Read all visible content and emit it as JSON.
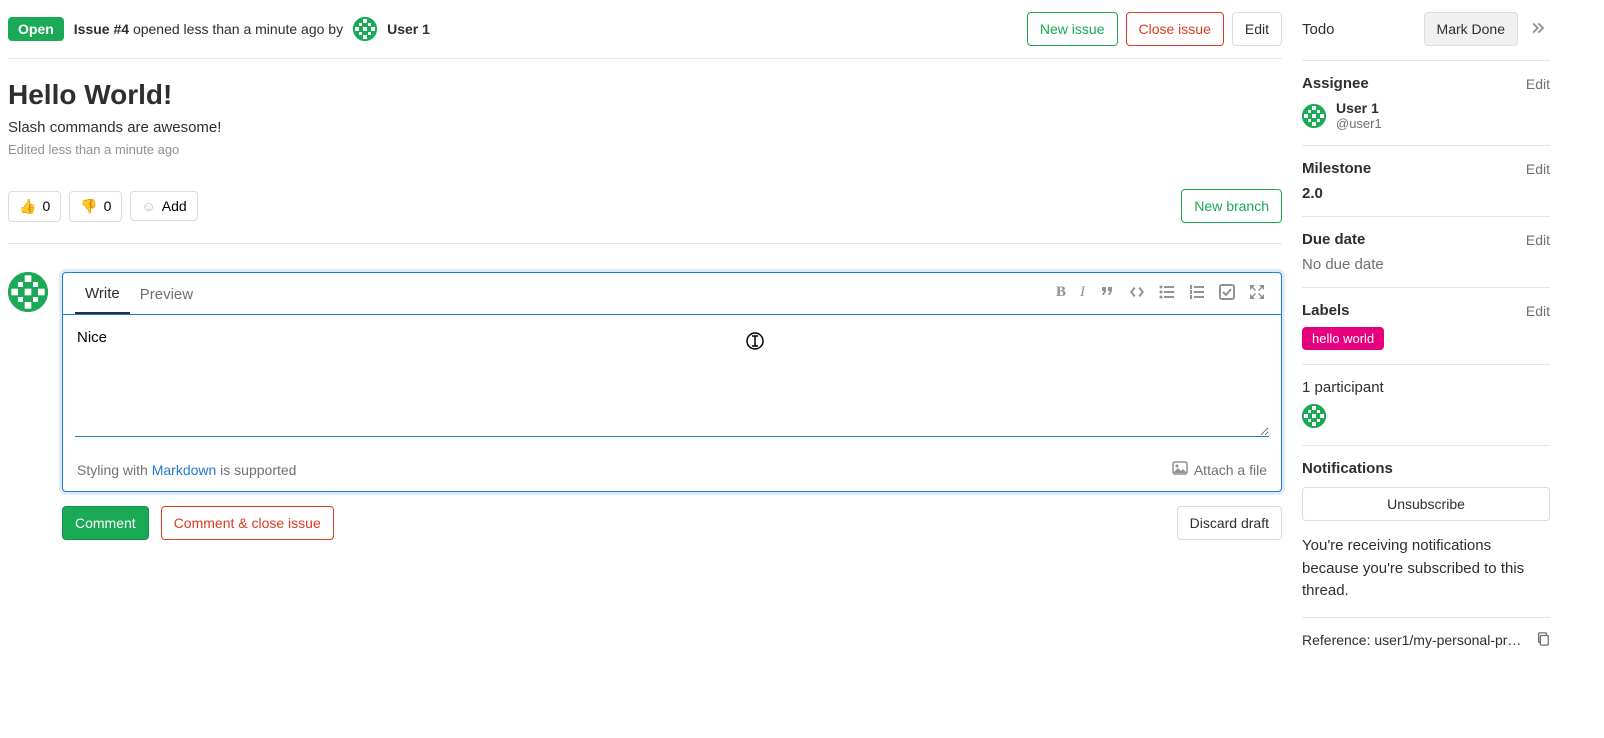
{
  "header": {
    "status_badge": "Open",
    "issue_ref": "Issue #4",
    "opened_text": "opened less than a minute ago by",
    "author": "User 1",
    "new_issue": "New issue",
    "close_issue": "Close issue",
    "edit": "Edit"
  },
  "issue": {
    "title": "Hello World!",
    "description": "Slash commands are awesome!",
    "edited_note": "Edited less than a minute ago"
  },
  "reactions": {
    "thumbs_up_count": "0",
    "thumbs_down_count": "0",
    "add_label": "Add",
    "new_branch": "New branch"
  },
  "editor": {
    "tab_write": "Write",
    "tab_preview": "Preview",
    "textarea_value": "Nice",
    "styling_prefix": "Styling with ",
    "styling_link": "Markdown",
    "styling_suffix": " is supported",
    "attach_label": "Attach a file"
  },
  "comment_actions": {
    "comment": "Comment",
    "comment_close": "Comment & close issue",
    "discard": "Discard draft"
  },
  "sidebar": {
    "todo_label": "Todo",
    "mark_done": "Mark Done",
    "assignee": {
      "title": "Assignee",
      "edit": "Edit",
      "name": "User 1",
      "handle": "@user1"
    },
    "milestone": {
      "title": "Milestone",
      "edit": "Edit",
      "value": "2.0"
    },
    "due_date": {
      "title": "Due date",
      "edit": "Edit",
      "value": "No due date"
    },
    "labels": {
      "title": "Labels",
      "edit": "Edit",
      "chip": "hello world"
    },
    "participants": {
      "text": "1 participant"
    },
    "notifications": {
      "title": "Notifications",
      "unsubscribe": "Unsubscribe",
      "reason": "You're receiving notifications because you're subscribed to this thread."
    },
    "reference": {
      "prefix": "Reference: ",
      "value": "user1/my-personal-pr…"
    }
  }
}
